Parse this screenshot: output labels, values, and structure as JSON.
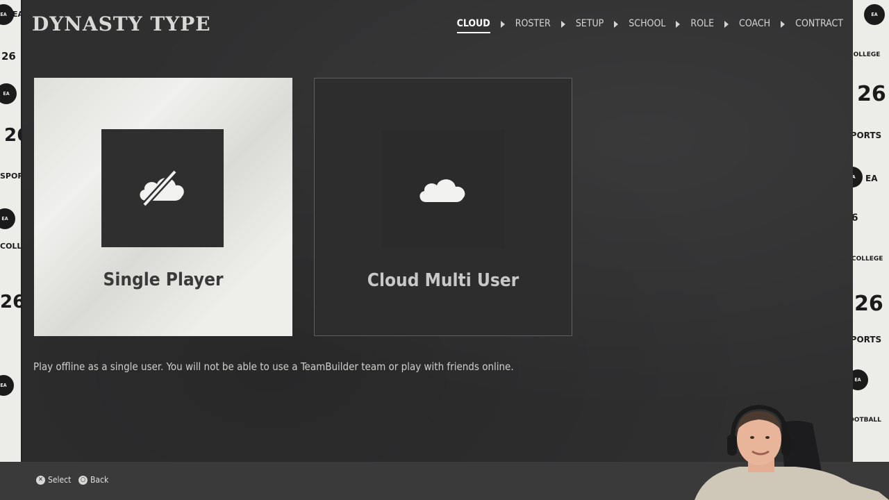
{
  "header": {
    "title": "DYNASTY TYPE"
  },
  "steps": [
    {
      "label": "CLOUD",
      "active": true
    },
    {
      "label": "ROSTER",
      "active": false
    },
    {
      "label": "SETUP",
      "active": false
    },
    {
      "label": "SCHOOL",
      "active": false
    },
    {
      "label": "ROLE",
      "active": false
    },
    {
      "label": "COACH",
      "active": false
    },
    {
      "label": "CONTRACT",
      "active": false
    }
  ],
  "options": {
    "single": {
      "label": "Single Player",
      "icon": "cloud-off-icon",
      "selected": true
    },
    "cloud": {
      "label": "Cloud Multi User",
      "icon": "cloud-icon",
      "selected": false
    }
  },
  "description": "Play offline as a single user. You will not be able to use a TeamBuilder team or play with friends online.",
  "footer": {
    "select_label": "Select",
    "back_label": "Back"
  },
  "wall_branding": {
    "ea": "EA",
    "sports": "SPORTS",
    "year": "26",
    "college": "COLLEGE",
    "football": "FOOTBALL"
  },
  "colors": {
    "background": "#2f2f30",
    "selected_card": "#e6e6e2",
    "text_light": "#d4d4d1",
    "footer_bar": "#3a3a3b"
  }
}
